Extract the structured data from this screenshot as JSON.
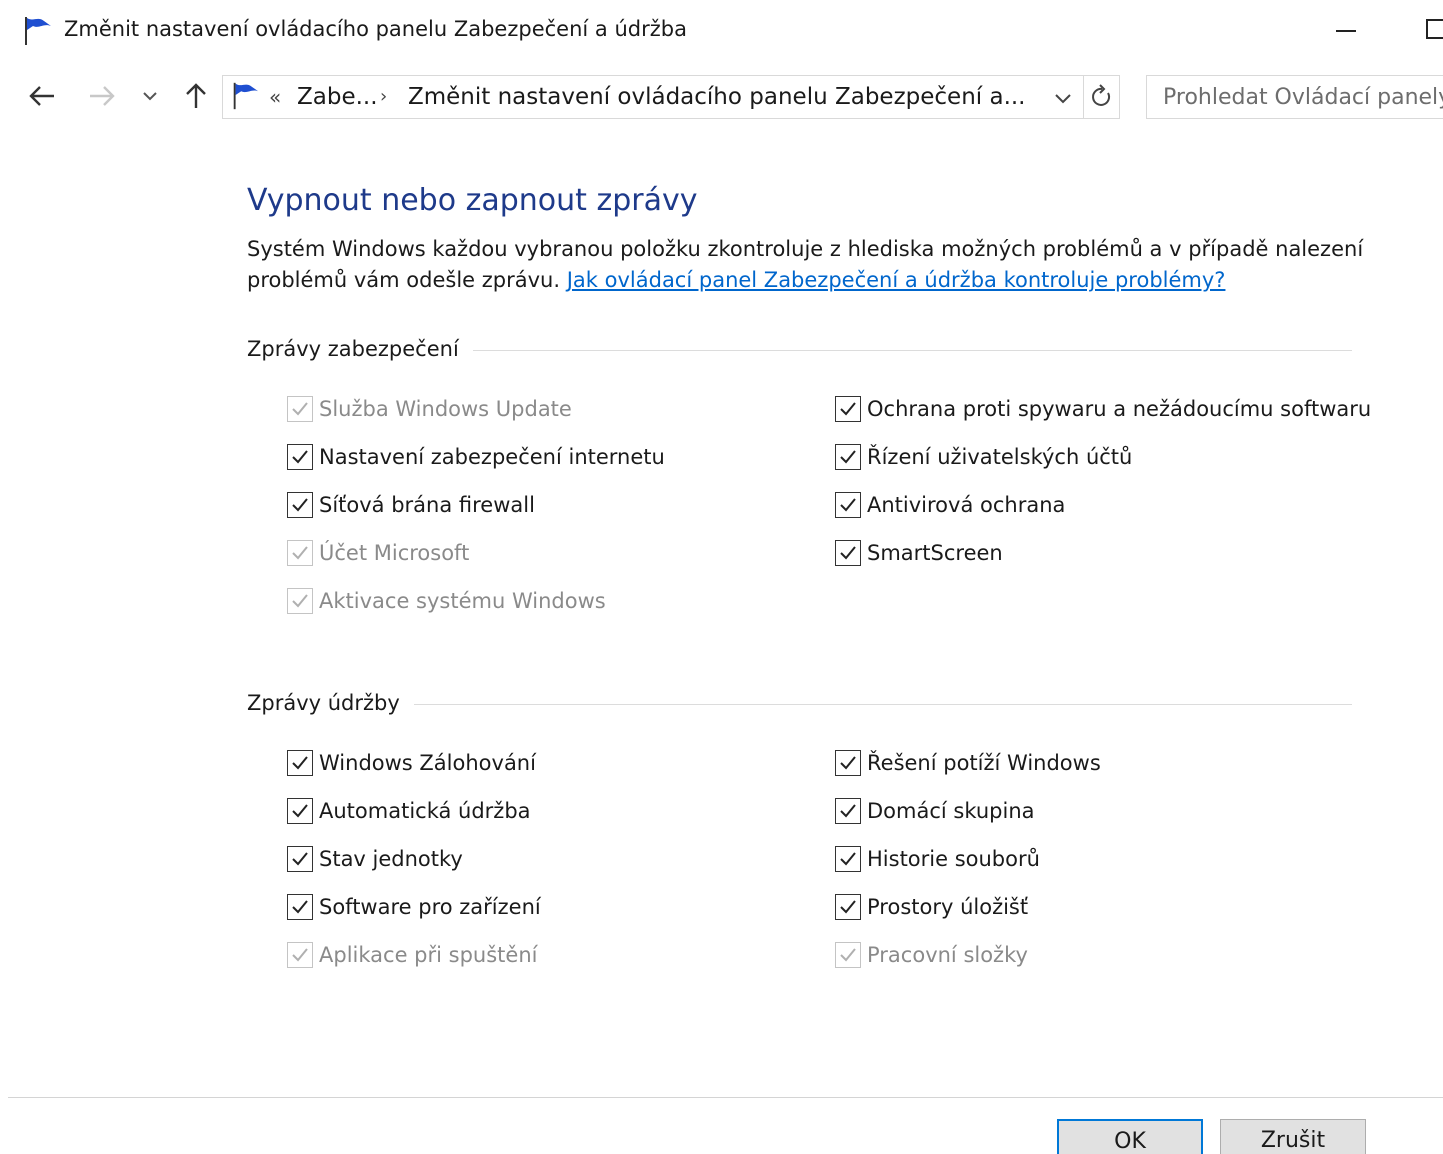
{
  "window": {
    "title": "Změnit nastavení ovládacího panelu Zabezpečení a údržba"
  },
  "address": {
    "chevrons": "«",
    "segment1": "Zabe...",
    "separator": "›",
    "segment2": "Změnit nastavení ovládacího panelu Zabezpečení a..."
  },
  "search": {
    "placeholder": "Prohledat Ovládací panely"
  },
  "content": {
    "heading": "Vypnout nebo zapnout zprávy",
    "description": "Systém Windows každou vybranou položku zkontroluje z hlediska možných problémů a v případě nalezení problémů vám odešle zprávu.",
    "link": "Jak ovládací panel Zabezpečení a údržba kontroluje problémy?"
  },
  "security": {
    "label": "Zprávy zabezpečení",
    "items": [
      {
        "label": "Služba Windows Update",
        "checked": true,
        "disabled": true
      },
      {
        "label": "Nastavení zabezpečení internetu",
        "checked": true,
        "disabled": false
      },
      {
        "label": "Síťová brána firewall",
        "checked": true,
        "disabled": false
      },
      {
        "label": "Účet Microsoft",
        "checked": true,
        "disabled": true
      },
      {
        "label": "Aktivace systému Windows",
        "checked": true,
        "disabled": true
      },
      {
        "label": "Ochrana proti spywaru a nežádoucímu softwaru",
        "checked": true,
        "disabled": false
      },
      {
        "label": "Řízení uživatelských účtů",
        "checked": true,
        "disabled": false
      },
      {
        "label": "Antivirová ochrana",
        "checked": true,
        "disabled": false
      },
      {
        "label": "SmartScreen",
        "checked": true,
        "disabled": false
      }
    ]
  },
  "maintenance": {
    "label": "Zprávy údržby",
    "items": [
      {
        "label": "Windows Zálohování",
        "checked": true,
        "disabled": false
      },
      {
        "label": "Automatická údržba",
        "checked": true,
        "disabled": false
      },
      {
        "label": "Stav jednotky",
        "checked": true,
        "disabled": false
      },
      {
        "label": "Software pro zařízení",
        "checked": true,
        "disabled": false
      },
      {
        "label": "Aplikace při spuštění",
        "checked": true,
        "disabled": true
      },
      {
        "label": "Řešení potíží Windows",
        "checked": true,
        "disabled": false
      },
      {
        "label": "Domácí skupina",
        "checked": true,
        "disabled": false
      },
      {
        "label": "Historie souborů",
        "checked": true,
        "disabled": false
      },
      {
        "label": "Prostory úložišť",
        "checked": true,
        "disabled": false
      },
      {
        "label": "Pracovní složky",
        "checked": true,
        "disabled": true
      }
    ]
  },
  "buttons": {
    "ok": "OK",
    "cancel": "Zrušit"
  },
  "colors": {
    "accent": "#0078d7",
    "heading": "#1e3a8a",
    "link": "#0066cc",
    "flag": "#1f4fd1"
  }
}
